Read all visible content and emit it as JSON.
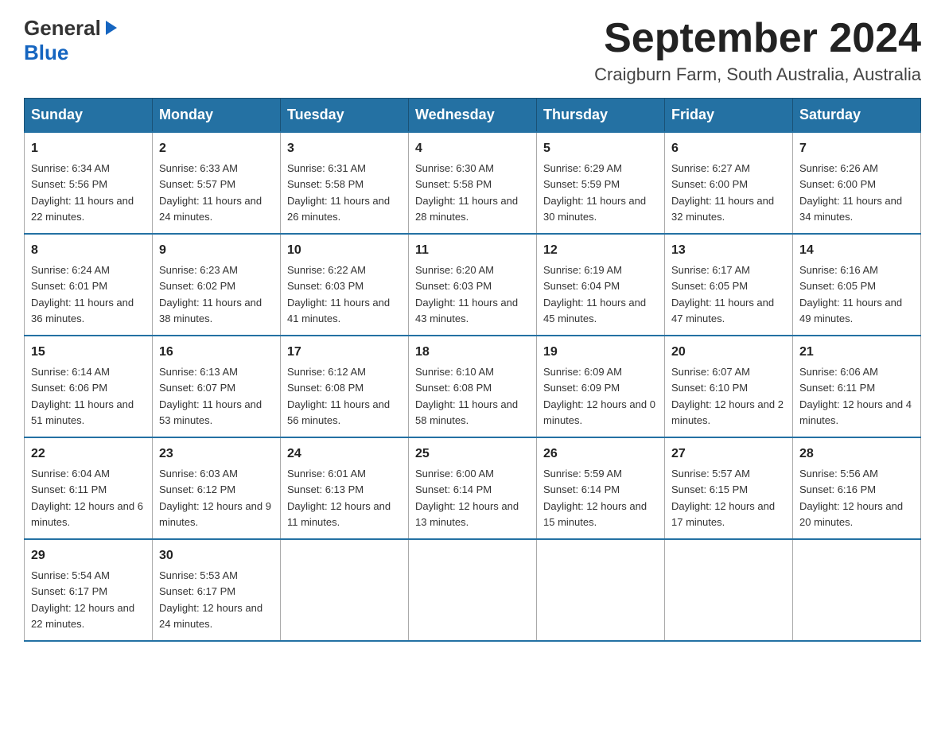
{
  "header": {
    "logo_general": "General",
    "logo_blue": "Blue",
    "month_title": "September 2024",
    "location": "Craigburn Farm, South Australia, Australia"
  },
  "weekdays": [
    "Sunday",
    "Monday",
    "Tuesday",
    "Wednesday",
    "Thursday",
    "Friday",
    "Saturday"
  ],
  "weeks": [
    [
      {
        "day": "1",
        "sunrise": "6:34 AM",
        "sunset": "5:56 PM",
        "daylight": "11 hours and 22 minutes."
      },
      {
        "day": "2",
        "sunrise": "6:33 AM",
        "sunset": "5:57 PM",
        "daylight": "11 hours and 24 minutes."
      },
      {
        "day": "3",
        "sunrise": "6:31 AM",
        "sunset": "5:58 PM",
        "daylight": "11 hours and 26 minutes."
      },
      {
        "day": "4",
        "sunrise": "6:30 AM",
        "sunset": "5:58 PM",
        "daylight": "11 hours and 28 minutes."
      },
      {
        "day": "5",
        "sunrise": "6:29 AM",
        "sunset": "5:59 PM",
        "daylight": "11 hours and 30 minutes."
      },
      {
        "day": "6",
        "sunrise": "6:27 AM",
        "sunset": "6:00 PM",
        "daylight": "11 hours and 32 minutes."
      },
      {
        "day": "7",
        "sunrise": "6:26 AM",
        "sunset": "6:00 PM",
        "daylight": "11 hours and 34 minutes."
      }
    ],
    [
      {
        "day": "8",
        "sunrise": "6:24 AM",
        "sunset": "6:01 PM",
        "daylight": "11 hours and 36 minutes."
      },
      {
        "day": "9",
        "sunrise": "6:23 AM",
        "sunset": "6:02 PM",
        "daylight": "11 hours and 38 minutes."
      },
      {
        "day": "10",
        "sunrise": "6:22 AM",
        "sunset": "6:03 PM",
        "daylight": "11 hours and 41 minutes."
      },
      {
        "day": "11",
        "sunrise": "6:20 AM",
        "sunset": "6:03 PM",
        "daylight": "11 hours and 43 minutes."
      },
      {
        "day": "12",
        "sunrise": "6:19 AM",
        "sunset": "6:04 PM",
        "daylight": "11 hours and 45 minutes."
      },
      {
        "day": "13",
        "sunrise": "6:17 AM",
        "sunset": "6:05 PM",
        "daylight": "11 hours and 47 minutes."
      },
      {
        "day": "14",
        "sunrise": "6:16 AM",
        "sunset": "6:05 PM",
        "daylight": "11 hours and 49 minutes."
      }
    ],
    [
      {
        "day": "15",
        "sunrise": "6:14 AM",
        "sunset": "6:06 PM",
        "daylight": "11 hours and 51 minutes."
      },
      {
        "day": "16",
        "sunrise": "6:13 AM",
        "sunset": "6:07 PM",
        "daylight": "11 hours and 53 minutes."
      },
      {
        "day": "17",
        "sunrise": "6:12 AM",
        "sunset": "6:08 PM",
        "daylight": "11 hours and 56 minutes."
      },
      {
        "day": "18",
        "sunrise": "6:10 AM",
        "sunset": "6:08 PM",
        "daylight": "11 hours and 58 minutes."
      },
      {
        "day": "19",
        "sunrise": "6:09 AM",
        "sunset": "6:09 PM",
        "daylight": "12 hours and 0 minutes."
      },
      {
        "day": "20",
        "sunrise": "6:07 AM",
        "sunset": "6:10 PM",
        "daylight": "12 hours and 2 minutes."
      },
      {
        "day": "21",
        "sunrise": "6:06 AM",
        "sunset": "6:11 PM",
        "daylight": "12 hours and 4 minutes."
      }
    ],
    [
      {
        "day": "22",
        "sunrise": "6:04 AM",
        "sunset": "6:11 PM",
        "daylight": "12 hours and 6 minutes."
      },
      {
        "day": "23",
        "sunrise": "6:03 AM",
        "sunset": "6:12 PM",
        "daylight": "12 hours and 9 minutes."
      },
      {
        "day": "24",
        "sunrise": "6:01 AM",
        "sunset": "6:13 PM",
        "daylight": "12 hours and 11 minutes."
      },
      {
        "day": "25",
        "sunrise": "6:00 AM",
        "sunset": "6:14 PM",
        "daylight": "12 hours and 13 minutes."
      },
      {
        "day": "26",
        "sunrise": "5:59 AM",
        "sunset": "6:14 PM",
        "daylight": "12 hours and 15 minutes."
      },
      {
        "day": "27",
        "sunrise": "5:57 AM",
        "sunset": "6:15 PM",
        "daylight": "12 hours and 17 minutes."
      },
      {
        "day": "28",
        "sunrise": "5:56 AM",
        "sunset": "6:16 PM",
        "daylight": "12 hours and 20 minutes."
      }
    ],
    [
      {
        "day": "29",
        "sunrise": "5:54 AM",
        "sunset": "6:17 PM",
        "daylight": "12 hours and 22 minutes."
      },
      {
        "day": "30",
        "sunrise": "5:53 AM",
        "sunset": "6:17 PM",
        "daylight": "12 hours and 24 minutes."
      },
      null,
      null,
      null,
      null,
      null
    ]
  ],
  "labels": {
    "sunrise": "Sunrise:",
    "sunset": "Sunset:",
    "daylight": "Daylight:"
  }
}
